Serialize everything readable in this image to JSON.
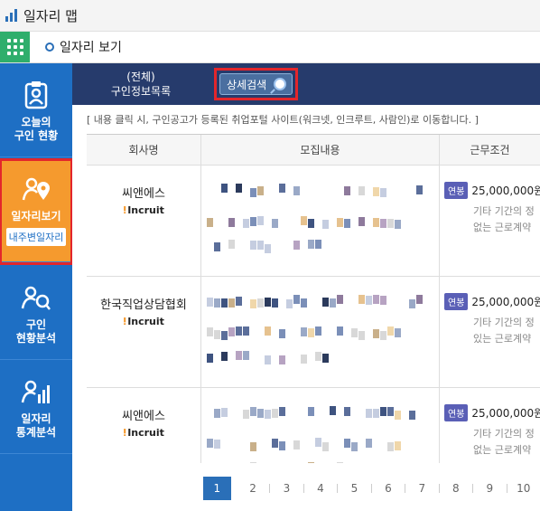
{
  "titlebar": {
    "title": "일자리 맵"
  },
  "navbar": {
    "label": "일자리 보기"
  },
  "sidebar": {
    "items": [
      {
        "label_1": "오늘의",
        "label_2": "구인 현황",
        "icon": "clipboard-person-icon"
      },
      {
        "label_1": "일자리보기",
        "sub": "내주변일자리",
        "icon": "person-location-icon",
        "active": true
      },
      {
        "label_1": "구인",
        "label_2": "현황분석",
        "icon": "person-search-icon"
      },
      {
        "label_1": "일자리",
        "label_2": "통계분석",
        "icon": "person-chart-icon"
      }
    ]
  },
  "main": {
    "list_title_1": "(전체)",
    "list_title_2": "구인정보목록",
    "search_button": "상세검색",
    "notice": "[ 내용 클릭 시, 구인공고가 등록된 취업포털 사이트(워크넷, 인크루트, 사람인)로 이동합니다. ]",
    "columns": [
      "회사명",
      "모집내용",
      "근무조건"
    ],
    "rows": [
      {
        "company": "씨앤에스",
        "portal": "Incruit",
        "salary_badge": "연봉",
        "salary": "25,000,000원",
        "cond_1": "기타 기간의 정",
        "cond_2": "없는 근로계약"
      },
      {
        "company": "한국직업상담협회",
        "portal": "Incruit",
        "salary_badge": "연봉",
        "salary": "25,000,000원",
        "cond_1": "기타 기간의 정",
        "cond_2": "있는 근로계약"
      },
      {
        "company": "씨앤에스",
        "portal": "Incruit",
        "salary_badge": "연봉",
        "salary": "25,000,000원",
        "cond_1": "기타 기간의 정",
        "cond_2": "없는 근로계약"
      }
    ],
    "pages": [
      "1",
      "2",
      "3",
      "4",
      "5",
      "6",
      "7",
      "8",
      "9",
      "10"
    ],
    "current_page": "1"
  },
  "colors": {
    "sidebar": "#1e6fc4",
    "active": "#f59a2e",
    "header": "#263b6c",
    "highlight": "#e3262b",
    "nav_green": "#2fae6c"
  }
}
